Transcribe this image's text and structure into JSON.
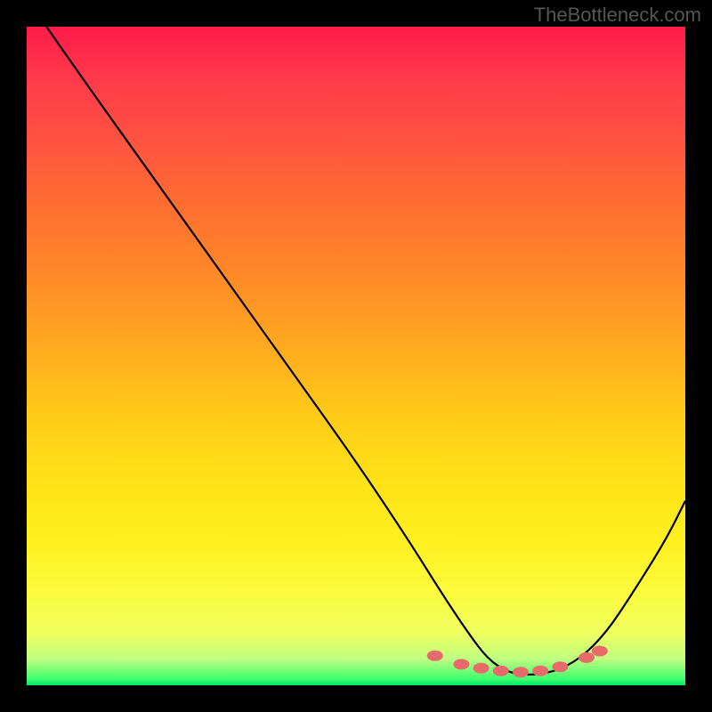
{
  "attribution": "TheBottleneck.com",
  "chart_data": {
    "type": "line",
    "title": "",
    "xlabel": "",
    "ylabel": "",
    "xlim": [
      0,
      100
    ],
    "ylim": [
      0,
      100
    ],
    "series": [
      {
        "name": "bottleneck-curve",
        "x": [
          3,
          10,
          20,
          30,
          40,
          50,
          58,
          63,
          67,
          70,
          73,
          76,
          80,
          84,
          88,
          92,
          97,
          100
        ],
        "y": [
          100,
          90,
          76,
          62,
          48,
          34,
          22,
          14,
          8,
          4,
          2,
          1.5,
          2,
          4,
          8,
          14,
          22,
          28
        ]
      }
    ],
    "markers": {
      "name": "highlight-dots",
      "color": "#e86a6a",
      "points": [
        {
          "x": 62,
          "y": 4.5
        },
        {
          "x": 66,
          "y": 3.2
        },
        {
          "x": 69,
          "y": 2.6
        },
        {
          "x": 72,
          "y": 2.2
        },
        {
          "x": 75,
          "y": 2.0
        },
        {
          "x": 78,
          "y": 2.2
        },
        {
          "x": 81,
          "y": 2.8
        },
        {
          "x": 85,
          "y": 4.2
        },
        {
          "x": 87,
          "y": 5.2
        }
      ]
    },
    "gradient_stops": [
      {
        "pos": 0,
        "color": "#ff1a4a"
      },
      {
        "pos": 50,
        "color": "#ffc018"
      },
      {
        "pos": 90,
        "color": "#fcfc3e"
      },
      {
        "pos": 100,
        "color": "#00e860"
      }
    ]
  }
}
